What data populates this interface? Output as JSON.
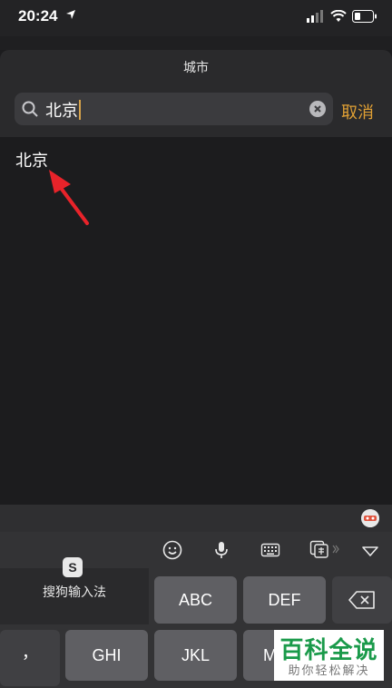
{
  "status_bar": {
    "time": "20:24"
  },
  "sheet": {
    "title": "城市"
  },
  "search": {
    "value": "北京",
    "cancel_label": "取消"
  },
  "results": [
    {
      "label": "北京"
    }
  ],
  "keyboard": {
    "ime_name": "搜狗输入法",
    "ime_logo": "S",
    "keys": {
      "abc": "ABC",
      "def": "DEF",
      "comma": "，",
      "ghi": "GHI",
      "jkl": "JKL",
      "mno": "M"
    }
  },
  "watermark": {
    "main": "百科全说",
    "sub": "助你轻松解决"
  },
  "colors": {
    "accent": "#e0a034",
    "arrow": "#e8232a",
    "watermark_green": "#1a9a4a"
  }
}
